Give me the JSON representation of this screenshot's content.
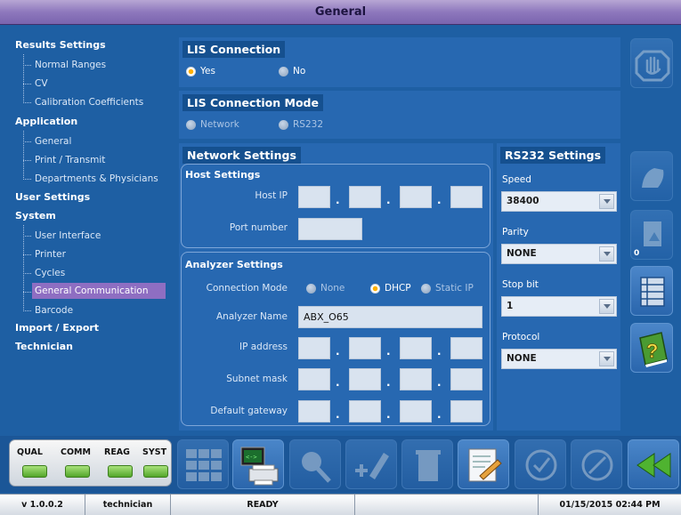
{
  "window": {
    "title": "General"
  },
  "tree": {
    "groups": [
      {
        "label": "Results Settings",
        "items": [
          "Normal Ranges",
          "CV",
          "Calibration Coefficients"
        ]
      },
      {
        "label": "Application",
        "items": [
          "General",
          "Print / Transmit",
          "Departments & Physicians"
        ]
      },
      {
        "label": "User Settings",
        "items": []
      },
      {
        "label": "System",
        "items": [
          "User Interface",
          "Printer",
          "Cycles",
          "General Communication",
          "Barcode"
        ]
      },
      {
        "label": "Import / Export",
        "items": []
      },
      {
        "label": "Technician",
        "items": []
      }
    ],
    "selected": "General Communication"
  },
  "lis_connection": {
    "title": "LIS Connection",
    "options": [
      "Yes",
      "No"
    ],
    "selected": "Yes"
  },
  "lis_mode": {
    "title": "LIS Connection Mode",
    "options": [
      "Network",
      "RS232"
    ]
  },
  "network": {
    "title": "Network Settings",
    "host": {
      "title": "Host Settings",
      "ip_label": "Host IP",
      "port_label": "Port number"
    },
    "analyzer": {
      "title": "Analyzer Settings",
      "connection_mode_label": "Connection Mode",
      "modes": [
        "None",
        "DHCP",
        "Static IP"
      ],
      "mode_selected": "DHCP",
      "name_label": "Analyzer Name",
      "name_value": "ABX_O65",
      "ip_label": "IP address",
      "subnet_label": "Subnet mask",
      "gateway_label": "Default gateway"
    }
  },
  "rs232": {
    "title": "RS232 Settings",
    "speed_label": "Speed",
    "speed_value": "38400",
    "parity_label": "Parity",
    "parity_value": "NONE",
    "stopbit_label": "Stop bit",
    "stopbit_value": "1",
    "protocol_label": "Protocol",
    "protocol_value": "NONE"
  },
  "side_counter": "0",
  "status_indicators": [
    "QUAL",
    "COMM",
    "REAG",
    "SYST"
  ],
  "footer": {
    "version": "v 1.0.0.2",
    "user": "technician",
    "state": "READY",
    "datetime": "01/15/2015 02:44 PM"
  },
  "colors": {
    "title_bar": "#8e78bd",
    "selected_item": "#8e6ec2",
    "led_green": "#53a72a",
    "background": "#1e5fa3"
  }
}
